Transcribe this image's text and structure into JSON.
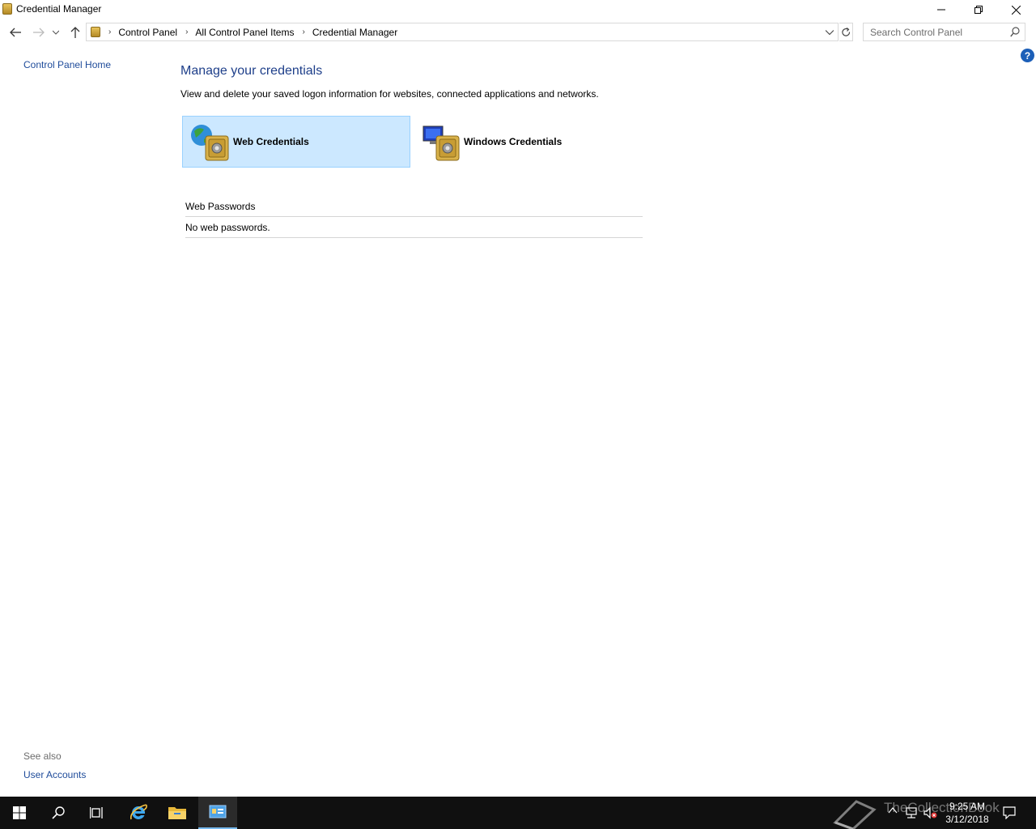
{
  "window": {
    "title": "Credential Manager",
    "buttons": {
      "minimize": "minimize",
      "restore": "restore",
      "close": "close"
    }
  },
  "nav": {
    "breadcrumbs": [
      "Control Panel",
      "All Control Panel Items",
      "Credential Manager"
    ],
    "search_placeholder": "Search Control Panel"
  },
  "left_pane": {
    "home_link": "Control Panel Home",
    "see_also_label": "See also",
    "see_also_links": [
      "User Accounts"
    ]
  },
  "main": {
    "heading": "Manage your credentials",
    "description": "View and delete your saved logon information for websites, connected applications and networks.",
    "tiles": [
      {
        "label": "Web Credentials",
        "selected": true,
        "icon": "globe-vault-icon"
      },
      {
        "label": "Windows Credentials",
        "selected": false,
        "icon": "computer-vault-icon"
      }
    ],
    "section_heading": "Web Passwords",
    "empty_message": "No web passwords."
  },
  "help": {
    "glyph": "?"
  },
  "taskbar": {
    "items": [
      "start-icon",
      "search-icon",
      "task-view-icon",
      "internet-explorer-icon",
      "file-explorer-icon",
      "control-panel-icon"
    ],
    "active_item": "control-panel-icon",
    "clock_time": "9:25 AM",
    "clock_date": "3/12/2018",
    "watermark": "TheCollectionBook"
  },
  "colors": {
    "link": "#1e4b9a",
    "heading": "#1e3f8a",
    "tile_selected_bg": "#cce8ff",
    "tile_selected_border": "#99d1ff",
    "taskbar_bg": "#101010"
  }
}
